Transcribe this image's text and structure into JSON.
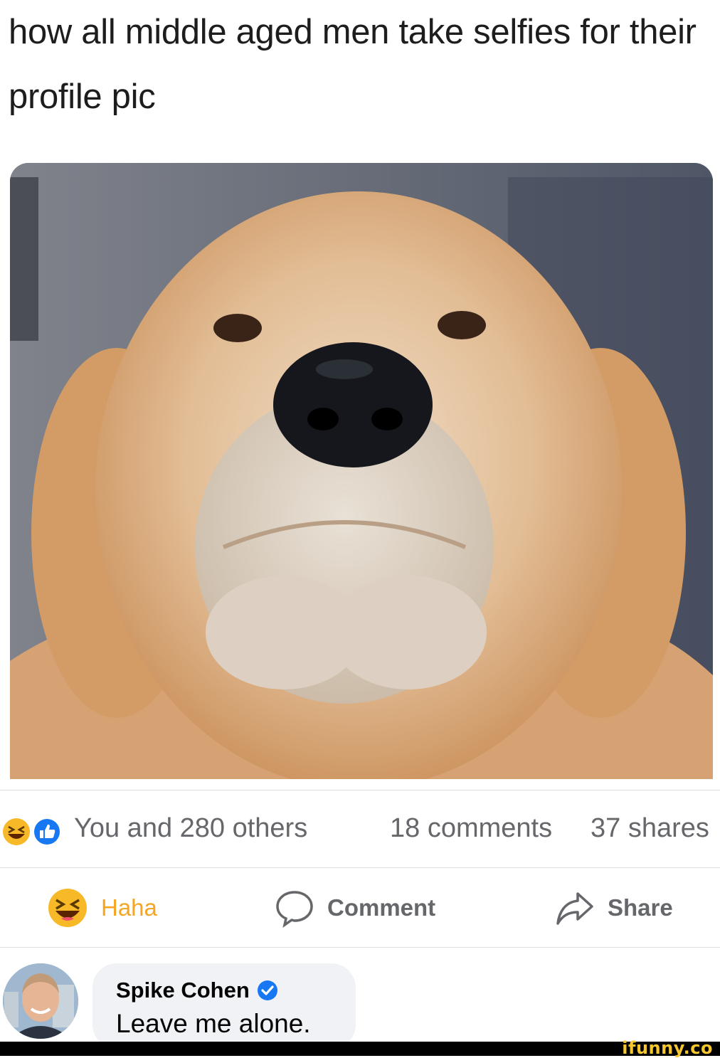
{
  "post": {
    "caption": "how all middle aged men take selfies for their profile pic"
  },
  "reactions": {
    "summary": "You and 280 others",
    "comments": "18 comments",
    "shares": "37 shares",
    "icons": [
      "haha-emoji-icon",
      "like-icon"
    ]
  },
  "actions": {
    "haha": "Haha",
    "comment": "Comment",
    "share": "Share"
  },
  "comment": {
    "author": "Spike Cohen",
    "text": "Leave me alone.",
    "verified": true
  },
  "watermark": "ifunny.co",
  "colors": {
    "haha_yellow": "#f7b928",
    "like_blue": "#1877f2",
    "muted_text": "#65676b",
    "bubble_bg": "#f0f2f5",
    "verified_blue": "#1877f2"
  }
}
